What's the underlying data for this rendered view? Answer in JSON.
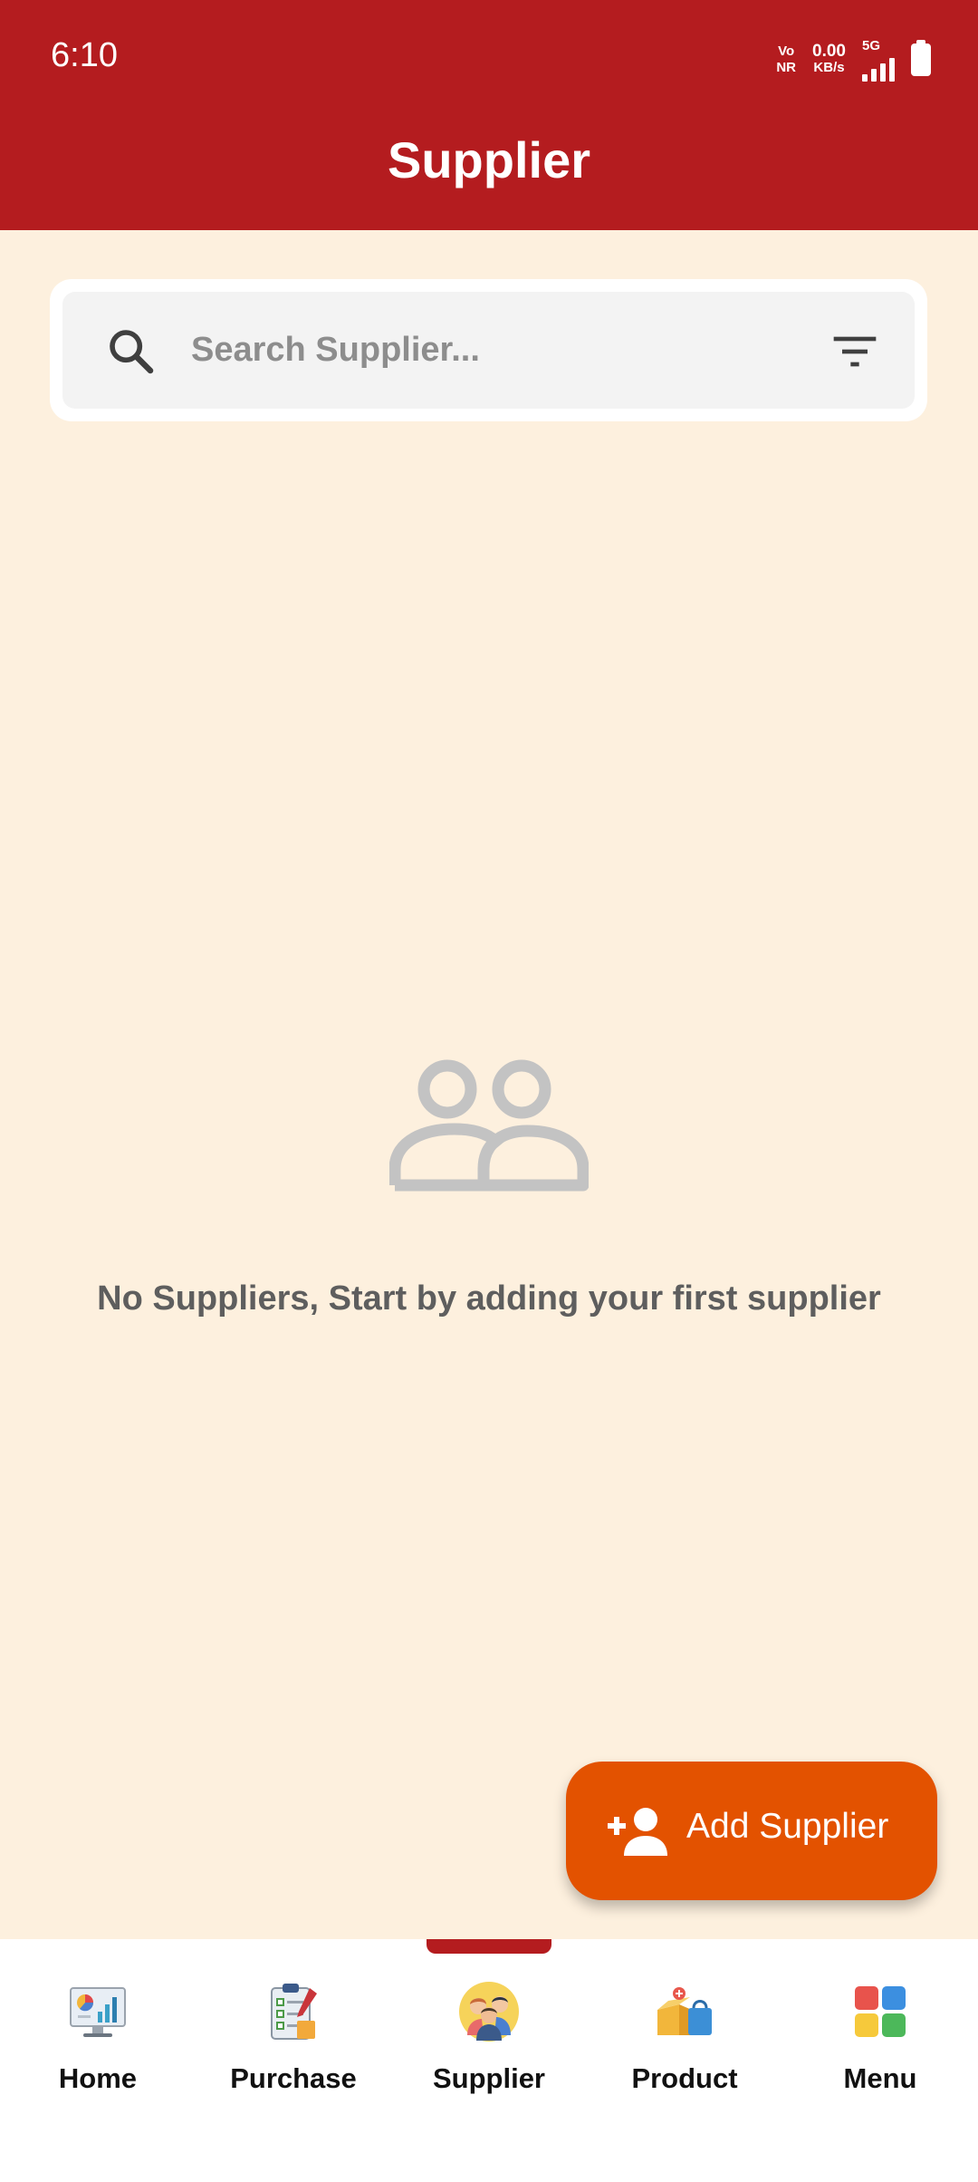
{
  "status_bar": {
    "time": "6:10",
    "network_top": "Vo",
    "network_bottom": "NR",
    "speed_value": "0.00",
    "speed_unit": "KB/s",
    "signal_label": "5G"
  },
  "app_bar": {
    "title": "Supplier"
  },
  "search": {
    "placeholder": "Search Supplier...",
    "value": "",
    "icon": "search-icon",
    "filter_icon": "filter-icon"
  },
  "empty_state": {
    "icon": "people-icon",
    "message": "No Suppliers, Start by adding your first supplier"
  },
  "fab": {
    "icon": "add-person-icon",
    "label": "Add Supplier"
  },
  "bottom_nav": {
    "active_index": 2,
    "items": [
      {
        "label": "Home",
        "icon": "dashboard-monitor-icon"
      },
      {
        "label": "Purchase",
        "icon": "clipboard-checklist-icon"
      },
      {
        "label": "Supplier",
        "icon": "supplier-people-icon"
      },
      {
        "label": "Product",
        "icon": "product-box-icon"
      },
      {
        "label": "Menu",
        "icon": "grid-menu-icon"
      }
    ]
  },
  "colors": {
    "primary": "#b41c1f",
    "background": "#fdf0de",
    "fab": "#e35200",
    "empty_text": "#5e5e5e"
  }
}
